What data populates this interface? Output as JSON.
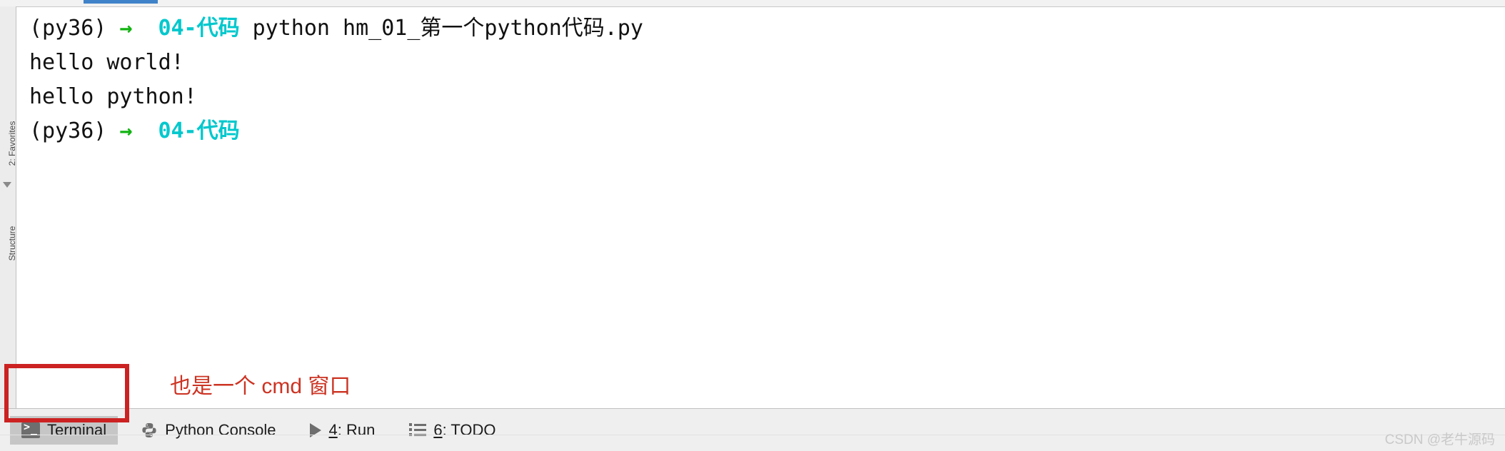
{
  "window": {
    "tab_indicator_color": "#4083c9"
  },
  "left_rail": {
    "items": [
      {
        "label": "2: Favorites",
        "name": "favorites"
      },
      {
        "label": "Structure",
        "name": "structure"
      }
    ]
  },
  "terminal": {
    "lines": [
      {
        "type": "prompt",
        "env": "(py36)",
        "arrow": "→",
        "dir": "04-代码",
        "command": "python hm_01_第一个python代码.py"
      },
      {
        "type": "output",
        "text": "hello world!"
      },
      {
        "type": "output",
        "text": "hello python!"
      },
      {
        "type": "prompt",
        "env": "(py36)",
        "arrow": "→",
        "dir": "04-代码",
        "command": ""
      }
    ],
    "colors": {
      "env": "#111111",
      "arrow": "#12b312",
      "dir": "#00c8cd",
      "text": "#111111",
      "background": "#ffffff"
    }
  },
  "annotation": {
    "text": "也是一个 cmd 窗口",
    "color": "#cc3322",
    "box_color": "#cc2222"
  },
  "bottom_bar": {
    "items": [
      {
        "label": "Terminal",
        "icon": "terminal-icon",
        "active": true,
        "mnemonic": ""
      },
      {
        "label": "Python Console",
        "icon": "python-icon",
        "active": false,
        "mnemonic": ""
      },
      {
        "label": "4: Run",
        "icon": "run-icon",
        "active": false,
        "mnemonic": "4"
      },
      {
        "label": "6: TODO",
        "icon": "todo-icon",
        "active": false,
        "mnemonic": "6"
      }
    ]
  },
  "watermark": {
    "text": "CSDN @老牛源码"
  }
}
